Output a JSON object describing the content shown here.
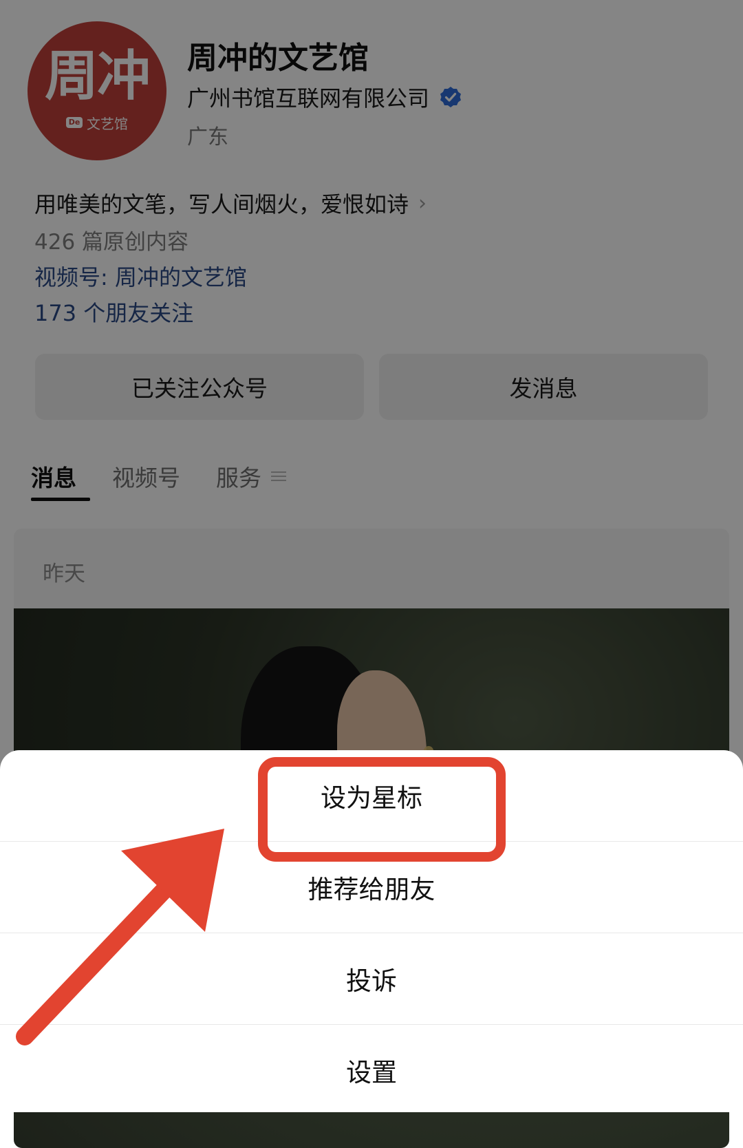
{
  "profile": {
    "avatar_text": "周冲",
    "avatar_subtext": "文艺馆",
    "avatar_mark": "De",
    "name": "周冲的文艺馆",
    "company": "广州书馆互联网有限公司",
    "region": "广东",
    "intro": "用唯美的文笔，写人间烟火，爱恨如诗",
    "original_count": "426 篇原创内容",
    "channel": "视频号: 周冲的文艺馆",
    "friends_following": "173 个朋友关注"
  },
  "actions": {
    "followed_label": "已关注公众号",
    "message_label": "发消息"
  },
  "tabs": [
    {
      "label": "消息",
      "active": true
    },
    {
      "label": "视频号",
      "active": false
    },
    {
      "label": "服务",
      "active": false
    }
  ],
  "feed": {
    "date": "昨天"
  },
  "sheet": {
    "items": [
      {
        "label": "设为星标"
      },
      {
        "label": "推荐给朋友"
      },
      {
        "label": "投诉"
      },
      {
        "label": "设置"
      }
    ]
  },
  "colors": {
    "accent_red": "#e24430",
    "avatar_red": "#c0403a",
    "link_blue": "#2b4a86",
    "verified_blue": "#2f6bd8"
  },
  "icons": {
    "verified": "verified-badge-icon",
    "chevron": "chevron-right-icon",
    "menu": "menu-lines-icon",
    "arrow": "arrow-annotation"
  }
}
